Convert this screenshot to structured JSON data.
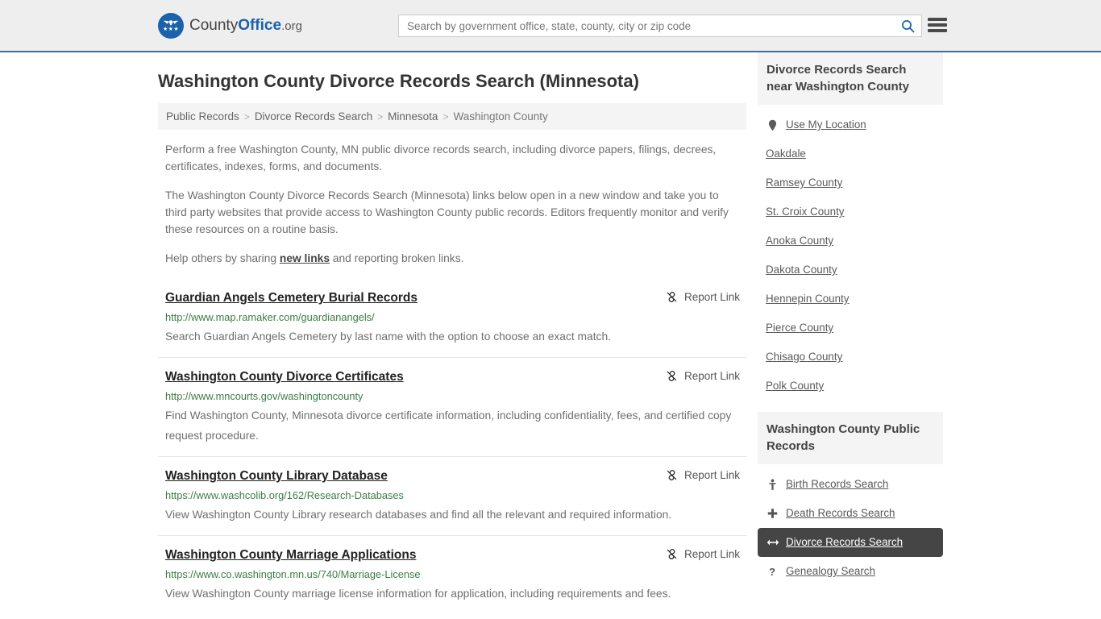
{
  "header": {
    "logo": {
      "text_county": "County",
      "text_office": "Office",
      "text_domain": ".org",
      "mark_icon": "eagle-emblem-icon",
      "stars": "★★★"
    },
    "search": {
      "placeholder": "Search by government office, state, county, city or zip code",
      "value": "",
      "search_icon": "search-icon"
    },
    "menu_icon": "hamburger-menu-icon"
  },
  "main": {
    "title": "Washington County Divorce Records Search (Minnesota)",
    "breadcrumb": {
      "items": [
        {
          "label": "Public Records",
          "current": false
        },
        {
          "label": "Divorce Records Search",
          "current": false
        },
        {
          "label": "Minnesota",
          "current": false
        },
        {
          "label": "Washington County",
          "current": true
        }
      ],
      "separator": ">"
    },
    "intro": {
      "p1": "Perform a free Washington County, MN public divorce records search, including divorce papers, filings, decrees, certificates, indexes, forms, and documents.",
      "p2": "The Washington County Divorce Records Search (Minnesota) links below open in a new window and take you to third party websites that provide access to Washington County public records. Editors frequently monitor and verify these resources on a routine basis.",
      "p3_before": "Help others by sharing ",
      "p3_link": "new links",
      "p3_after": " and reporting broken links."
    },
    "report_link_label": "Report Link",
    "report_link_icon": "broken-link-icon",
    "results": [
      {
        "title": "Guardian Angels Cemetery Burial Records",
        "url": "http://www.map.ramaker.com/guardianangels/",
        "description": "Search Guardian Angels Cemetery by last name with the option to choose an exact match."
      },
      {
        "title": "Washington County Divorce Certificates",
        "url": "http://www.mncourts.gov/washingtoncounty",
        "description": "Find Washington County, Minnesota divorce certificate information, including confidentiality, fees, and certified copy request procedure."
      },
      {
        "title": "Washington County Library Database",
        "url": "https://www.washcolib.org/162/Research-Databases",
        "description": "View Washington County Library research databases and find all the relevant and required information."
      },
      {
        "title": "Washington County Marriage Applications",
        "url": "https://www.co.washington.mn.us/740/Marriage-License",
        "description": "View Washington County marriage license information for application, including requirements and fees."
      }
    ]
  },
  "sidebar": {
    "nearby": {
      "heading": "Divorce Records Search near Washington County",
      "items": [
        {
          "label": "Use My Location",
          "icon": "map-pin-icon"
        },
        {
          "label": "Oakdale",
          "icon": ""
        },
        {
          "label": "Ramsey County",
          "icon": ""
        },
        {
          "label": "St. Croix County",
          "icon": ""
        },
        {
          "label": "Anoka County",
          "icon": ""
        },
        {
          "label": "Dakota County",
          "icon": ""
        },
        {
          "label": "Hennepin County",
          "icon": ""
        },
        {
          "label": "Pierce County",
          "icon": ""
        },
        {
          "label": "Chisago County",
          "icon": ""
        },
        {
          "label": "Polk County",
          "icon": ""
        }
      ]
    },
    "public_records": {
      "heading": "Washington County Public Records",
      "items": [
        {
          "label": "Birth Records Search",
          "icon": "baby-icon",
          "active": false
        },
        {
          "label": "Death Records Search",
          "icon": "cross-icon",
          "active": false
        },
        {
          "label": "Divorce Records Search",
          "icon": "split-arrows-icon",
          "active": true
        },
        {
          "label": "Genealogy Search",
          "icon": "question-mark-icon",
          "active": false
        }
      ]
    }
  },
  "colors": {
    "header_bg": "#eeeeee",
    "header_border": "#3f6e9e",
    "brand_blue": "#1b62ab",
    "url_green": "#3c7d45",
    "active_bg": "#454545",
    "panel_bg": "#f4f4f4"
  }
}
